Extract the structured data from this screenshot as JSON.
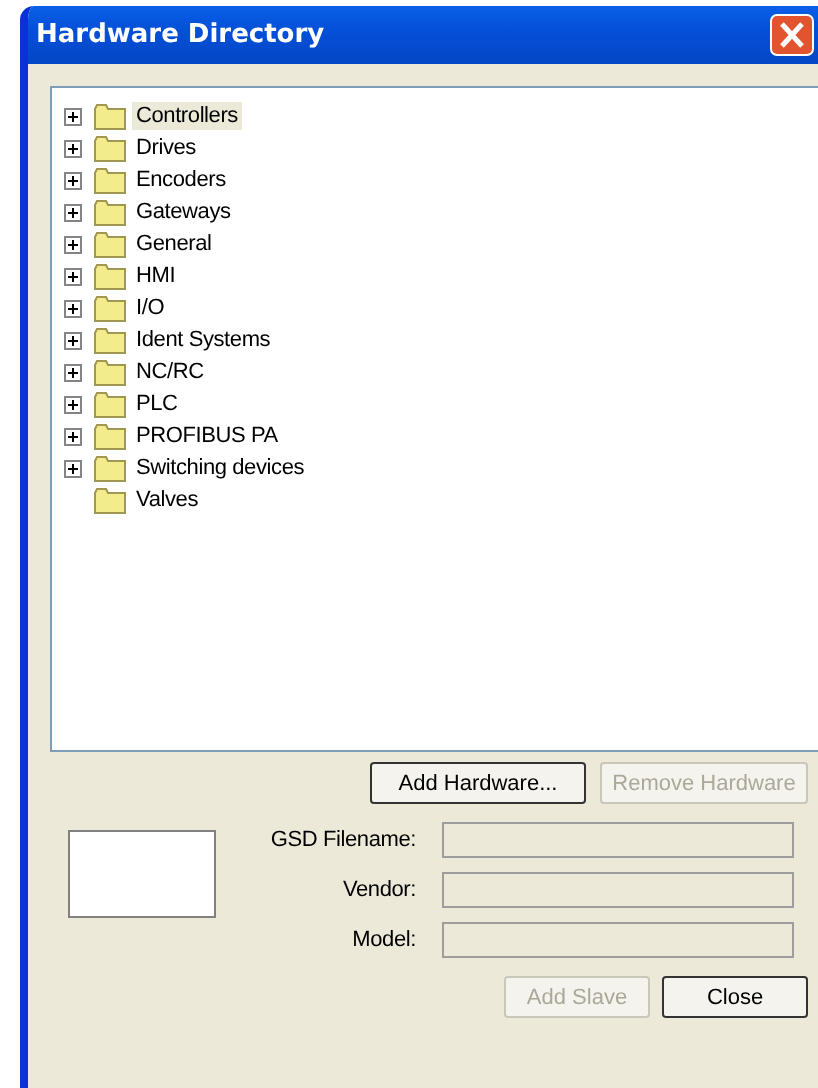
{
  "window": {
    "title": "Hardware Directory"
  },
  "tree": {
    "items": [
      {
        "label": "Controllers",
        "expandable": true,
        "selected": true
      },
      {
        "label": "Drives",
        "expandable": true,
        "selected": false
      },
      {
        "label": "Encoders",
        "expandable": true,
        "selected": false
      },
      {
        "label": "Gateways",
        "expandable": true,
        "selected": false
      },
      {
        "label": "General",
        "expandable": true,
        "selected": false
      },
      {
        "label": "HMI",
        "expandable": true,
        "selected": false
      },
      {
        "label": "I/O",
        "expandable": true,
        "selected": false
      },
      {
        "label": "Ident Systems",
        "expandable": true,
        "selected": false
      },
      {
        "label": "NC/RC",
        "expandable": true,
        "selected": false
      },
      {
        "label": "PLC",
        "expandable": true,
        "selected": false
      },
      {
        "label": "PROFIBUS PA",
        "expandable": true,
        "selected": false
      },
      {
        "label": "Switching devices",
        "expandable": true,
        "selected": false
      },
      {
        "label": "Valves",
        "expandable": false,
        "selected": false
      }
    ]
  },
  "tree_buttons": [
    {
      "label": "Add Hardware...",
      "disabled": false
    },
    {
      "label": "Remove Hardware",
      "disabled": true
    }
  ],
  "fields": [
    {
      "label": "GSD Filename:"
    },
    {
      "label": "Vendor:"
    },
    {
      "label": "Model:"
    }
  ],
  "buttons": [
    {
      "label": "Add Slave",
      "disabled": true
    },
    {
      "label": "Close",
      "disabled": false
    }
  ]
}
